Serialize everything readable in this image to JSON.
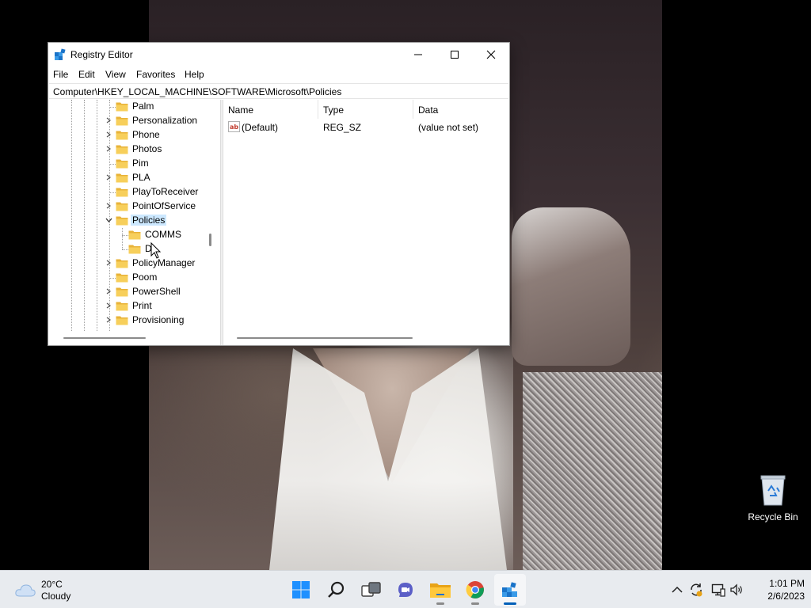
{
  "window": {
    "title": "Registry Editor",
    "menu": [
      "File",
      "Edit",
      "View",
      "Favorites",
      "Help"
    ],
    "address": "Computer\\HKEY_LOCAL_MACHINE\\SOFTWARE\\Microsoft\\Policies"
  },
  "tree": {
    "items": [
      {
        "label": "Palm",
        "expandable": false,
        "level": 1
      },
      {
        "label": "Personalization",
        "expandable": true,
        "level": 1
      },
      {
        "label": "Phone",
        "expandable": true,
        "level": 1
      },
      {
        "label": "Photos",
        "expandable": true,
        "level": 1
      },
      {
        "label": "Pim",
        "expandable": false,
        "level": 1
      },
      {
        "label": "PLA",
        "expandable": true,
        "level": 1
      },
      {
        "label": "PlayToReceiver",
        "expandable": false,
        "level": 1
      },
      {
        "label": "PointOfService",
        "expandable": true,
        "level": 1
      },
      {
        "label": "Policies",
        "expandable": true,
        "expanded": true,
        "selected": true,
        "level": 1
      },
      {
        "label": "COMMS",
        "expandable": false,
        "level": 2
      },
      {
        "label": "DI",
        "expandable": false,
        "level": 2
      },
      {
        "label": "PolicyManager",
        "expandable": true,
        "level": 1
      },
      {
        "label": "Poom",
        "expandable": false,
        "level": 1
      },
      {
        "label": "PowerShell",
        "expandable": true,
        "level": 1
      },
      {
        "label": "Print",
        "expandable": true,
        "level": 1
      },
      {
        "label": "Provisioning",
        "expandable": true,
        "level": 1
      }
    ]
  },
  "list": {
    "columns": [
      "Name",
      "Type",
      "Data"
    ],
    "rows": [
      {
        "name": "(Default)",
        "type": "REG_SZ",
        "data": "(value not set)"
      }
    ]
  },
  "desktop": {
    "recycle_bin_label": "Recycle Bin"
  },
  "taskbar": {
    "weather_temp": "20°C",
    "weather_condition": "Cloudy",
    "time": "1:01 PM",
    "date": "2/6/2023",
    "apps": [
      "start",
      "search",
      "task-view",
      "chat",
      "file-explorer",
      "chrome",
      "registry-editor"
    ]
  },
  "colors": {
    "selection": "#cce8ff",
    "folder": "#f4c74f",
    "taskbar_bg": "#e8ebef",
    "accent": "#005fb8"
  }
}
